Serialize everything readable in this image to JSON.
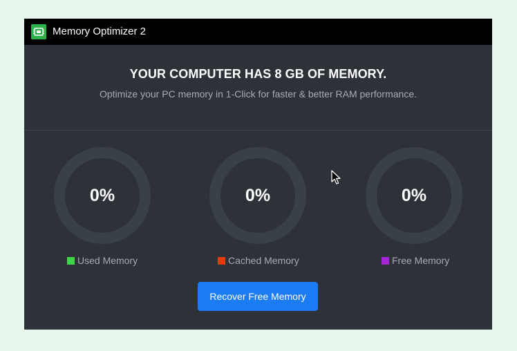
{
  "window": {
    "title": "Memory Optimizer 2",
    "icon": "memory-chip-icon"
  },
  "header": {
    "headline": "YOUR COMPUTER HAS 8 GB OF MEMORY.",
    "subline": "Optimize your PC memory in 1-Click for faster & better RAM performance."
  },
  "gauges": [
    {
      "value": "0%",
      "label": "Used Memory",
      "color": "#3fd34a"
    },
    {
      "value": "0%",
      "label": "Cached Memory",
      "color": "#e8380d"
    },
    {
      "value": "0%",
      "label": "Free Memory",
      "color": "#a526d6"
    }
  ],
  "actions": {
    "recover_label": "Recover Free Memory"
  },
  "colors": {
    "window_bg": "#2d3238",
    "titlebar_bg": "#000000",
    "ring": "#3a4048",
    "accent": "#1c7cf4",
    "app_icon": "#2db24a"
  }
}
